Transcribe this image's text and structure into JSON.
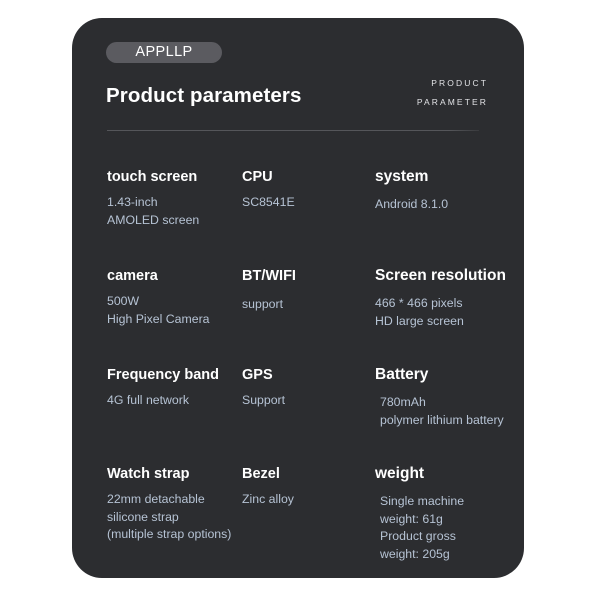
{
  "card": {
    "brand_badge": "APPLLP",
    "title": "Product parameters",
    "eyebrow_line1": "PRODUCT",
    "eyebrow_line2": "PARAMETER",
    "bg_color": "#2c2d30",
    "label_color": "#ffffff",
    "value_color": "#b6c3d4",
    "badge_color": "#5b5b60"
  },
  "specs": [
    [
      {
        "label": "touch screen",
        "value": "1.43-inch\nAMOLED screen"
      },
      {
        "label": "CPU",
        "value": "SC8541E"
      },
      {
        "label": "system",
        "value": "Android 8.1.0"
      }
    ],
    [
      {
        "label": "camera",
        "value": "500W\nHigh Pixel Camera"
      },
      {
        "label": "BT/WIFI",
        "value": "support"
      },
      {
        "label": "Screen resolution",
        "value": "466 * 466 pixels\nHD large screen"
      }
    ],
    [
      {
        "label": "Frequency band",
        "value": "4G full network"
      },
      {
        "label": "GPS",
        "value": "Support"
      },
      {
        "label": "Battery",
        "value": "780mAh\npolymer lithium battery"
      }
    ],
    [
      {
        "label": "Watch strap",
        "value": "22mm detachable\nsilicone strap\n(multiple strap options)"
      },
      {
        "label": "Bezel",
        "value": "Zinc alloy"
      },
      {
        "label": "weight",
        "value": "Single machine\nweight: 61g\n Product gross\nweight: 205g"
      }
    ]
  ]
}
